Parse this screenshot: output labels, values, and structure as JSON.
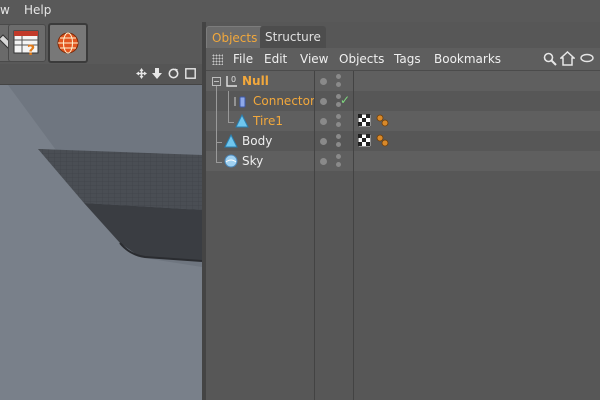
{
  "menu": {
    "items": [
      "w",
      "Help"
    ]
  },
  "tabs": [
    {
      "label": "Objects"
    },
    {
      "label": "Structure"
    }
  ],
  "object_menu": {
    "items": [
      "File",
      "Edit",
      "View",
      "Objects",
      "Tags",
      "Bookmarks"
    ]
  },
  "objects": [
    {
      "name": "Null",
      "highlight": true
    },
    {
      "name": "Connector",
      "highlight": true
    },
    {
      "name": "Tire1",
      "highlight": true
    },
    {
      "name": "Body",
      "highlight": false
    },
    {
      "name": "Sky",
      "highlight": false
    }
  ],
  "colors": {
    "accent": "#f2a83c",
    "viewport": "#6f7680",
    "panel": "#575757"
  },
  "icons": {
    "toolbar": [
      "tool-icon",
      "render-settings-icon",
      "globe-icon"
    ],
    "viewport_nav": [
      "move-icon",
      "down-arrow-icon",
      "rotate-icon",
      "maximize-icon"
    ],
    "object_manager": [
      "search-icon",
      "home-icon",
      "eye-icon"
    ]
  }
}
